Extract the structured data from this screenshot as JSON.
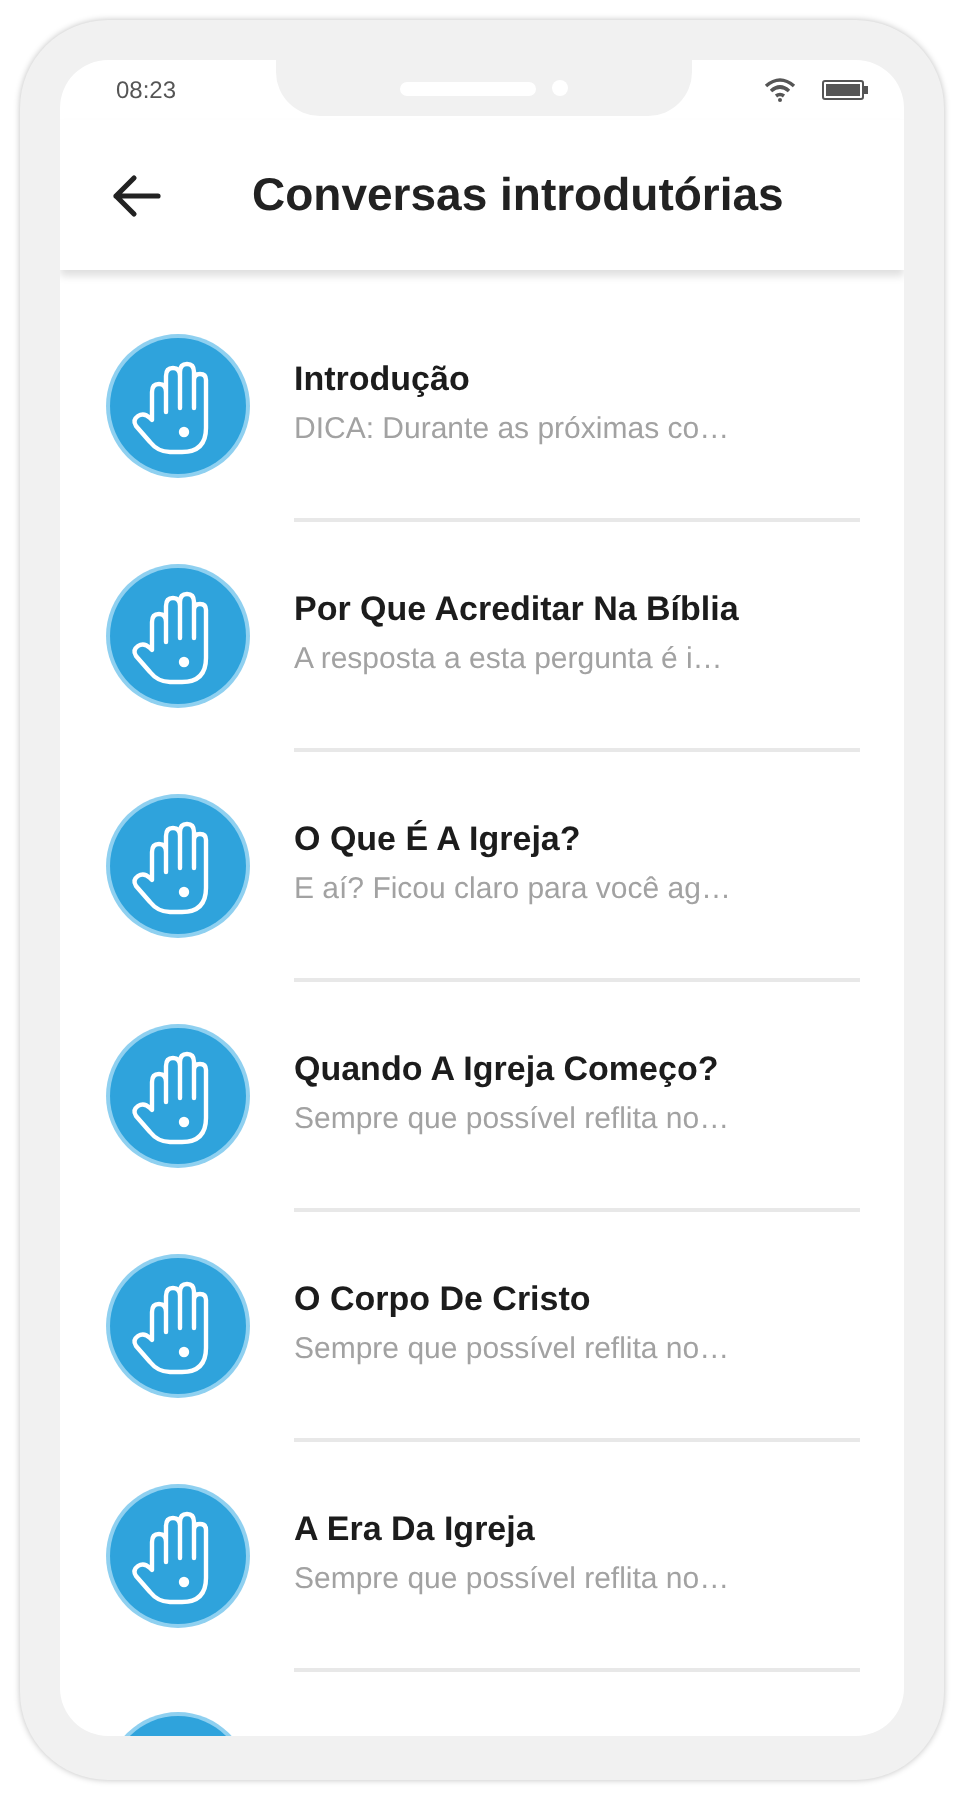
{
  "status_bar": {
    "time": "08:23"
  },
  "header": {
    "title": "Conversas introdutórias"
  },
  "items": [
    {
      "title": "Introdução",
      "subtitle": "DICA: Durante as próximas co…"
    },
    {
      "title": "Por Que Acreditar Na Bíblia",
      "subtitle": "A resposta a esta pergunta é i…"
    },
    {
      "title": "O Que É A Igreja?",
      "subtitle": "E aí? Ficou claro para você ag…"
    },
    {
      "title": "Quando A Igreja Começo?",
      "subtitle": "Sempre que possível reflita no…"
    },
    {
      "title": "O Corpo De Cristo",
      "subtitle": "Sempre que possível reflita no…"
    },
    {
      "title": "A Era Da Igreja",
      "subtitle": "Sempre que possível reflita no…"
    }
  ]
}
